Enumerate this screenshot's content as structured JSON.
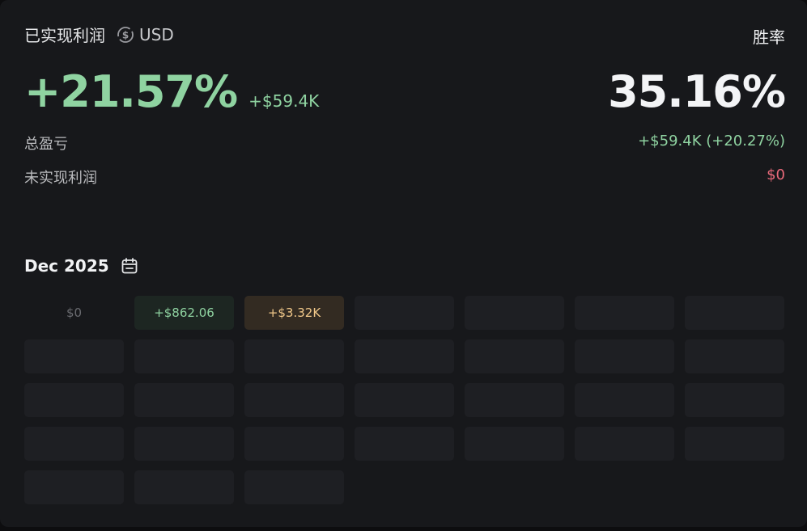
{
  "header": {
    "title": "已实现利润",
    "currency": "USD",
    "right_title": "胜率"
  },
  "pnl": {
    "percent": "+21.57%",
    "amount": "+$59.4K",
    "winrate": "35.16%"
  },
  "rows": [
    {
      "label": "总盈亏",
      "value": "+$59.4K (+20.27%)"
    },
    {
      "label": "未实现利润",
      "value": "$0"
    }
  ],
  "calendar": {
    "month": "Dec 2025",
    "days": [
      {
        "text": "$0"
      },
      {
        "text": "+$862.06"
      },
      {
        "text": "+$3.32K"
      }
    ]
  },
  "colors": {
    "positive": "#8fd3a1",
    "negative": "#e8697a",
    "highlight": "#f2c98a"
  }
}
